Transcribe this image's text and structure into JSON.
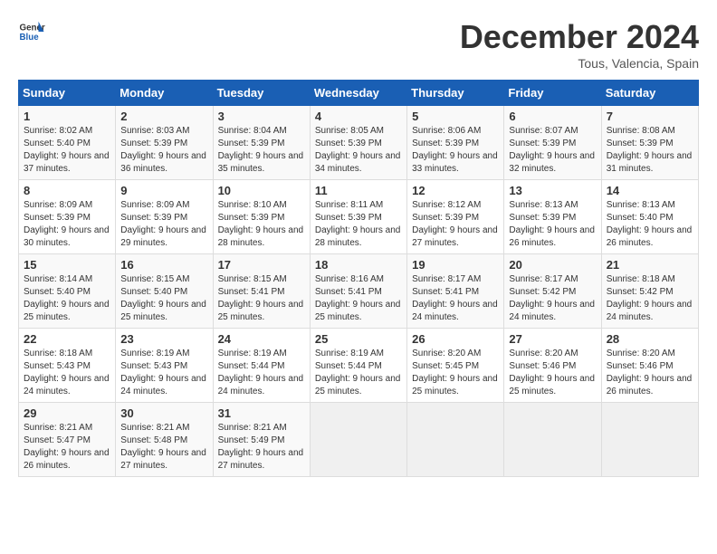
{
  "header": {
    "logo_text_general": "General",
    "logo_text_blue": "Blue",
    "month_title": "December 2024",
    "location": "Tous, Valencia, Spain"
  },
  "calendar": {
    "days_of_week": [
      "Sunday",
      "Monday",
      "Tuesday",
      "Wednesday",
      "Thursday",
      "Friday",
      "Saturday"
    ],
    "weeks": [
      [
        {
          "day": "1",
          "sunrise": "Sunrise: 8:02 AM",
          "sunset": "Sunset: 5:40 PM",
          "daylight": "Daylight: 9 hours and 37 minutes."
        },
        {
          "day": "2",
          "sunrise": "Sunrise: 8:03 AM",
          "sunset": "Sunset: 5:39 PM",
          "daylight": "Daylight: 9 hours and 36 minutes."
        },
        {
          "day": "3",
          "sunrise": "Sunrise: 8:04 AM",
          "sunset": "Sunset: 5:39 PM",
          "daylight": "Daylight: 9 hours and 35 minutes."
        },
        {
          "day": "4",
          "sunrise": "Sunrise: 8:05 AM",
          "sunset": "Sunset: 5:39 PM",
          "daylight": "Daylight: 9 hours and 34 minutes."
        },
        {
          "day": "5",
          "sunrise": "Sunrise: 8:06 AM",
          "sunset": "Sunset: 5:39 PM",
          "daylight": "Daylight: 9 hours and 33 minutes."
        },
        {
          "day": "6",
          "sunrise": "Sunrise: 8:07 AM",
          "sunset": "Sunset: 5:39 PM",
          "daylight": "Daylight: 9 hours and 32 minutes."
        },
        {
          "day": "7",
          "sunrise": "Sunrise: 8:08 AM",
          "sunset": "Sunset: 5:39 PM",
          "daylight": "Daylight: 9 hours and 31 minutes."
        }
      ],
      [
        {
          "day": "8",
          "sunrise": "Sunrise: 8:09 AM",
          "sunset": "Sunset: 5:39 PM",
          "daylight": "Daylight: 9 hours and 30 minutes."
        },
        {
          "day": "9",
          "sunrise": "Sunrise: 8:09 AM",
          "sunset": "Sunset: 5:39 PM",
          "daylight": "Daylight: 9 hours and 29 minutes."
        },
        {
          "day": "10",
          "sunrise": "Sunrise: 8:10 AM",
          "sunset": "Sunset: 5:39 PM",
          "daylight": "Daylight: 9 hours and 28 minutes."
        },
        {
          "day": "11",
          "sunrise": "Sunrise: 8:11 AM",
          "sunset": "Sunset: 5:39 PM",
          "daylight": "Daylight: 9 hours and 28 minutes."
        },
        {
          "day": "12",
          "sunrise": "Sunrise: 8:12 AM",
          "sunset": "Sunset: 5:39 PM",
          "daylight": "Daylight: 9 hours and 27 minutes."
        },
        {
          "day": "13",
          "sunrise": "Sunrise: 8:13 AM",
          "sunset": "Sunset: 5:39 PM",
          "daylight": "Daylight: 9 hours and 26 minutes."
        },
        {
          "day": "14",
          "sunrise": "Sunrise: 8:13 AM",
          "sunset": "Sunset: 5:40 PM",
          "daylight": "Daylight: 9 hours and 26 minutes."
        }
      ],
      [
        {
          "day": "15",
          "sunrise": "Sunrise: 8:14 AM",
          "sunset": "Sunset: 5:40 PM",
          "daylight": "Daylight: 9 hours and 25 minutes."
        },
        {
          "day": "16",
          "sunrise": "Sunrise: 8:15 AM",
          "sunset": "Sunset: 5:40 PM",
          "daylight": "Daylight: 9 hours and 25 minutes."
        },
        {
          "day": "17",
          "sunrise": "Sunrise: 8:15 AM",
          "sunset": "Sunset: 5:41 PM",
          "daylight": "Daylight: 9 hours and 25 minutes."
        },
        {
          "day": "18",
          "sunrise": "Sunrise: 8:16 AM",
          "sunset": "Sunset: 5:41 PM",
          "daylight": "Daylight: 9 hours and 25 minutes."
        },
        {
          "day": "19",
          "sunrise": "Sunrise: 8:17 AM",
          "sunset": "Sunset: 5:41 PM",
          "daylight": "Daylight: 9 hours and 24 minutes."
        },
        {
          "day": "20",
          "sunrise": "Sunrise: 8:17 AM",
          "sunset": "Sunset: 5:42 PM",
          "daylight": "Daylight: 9 hours and 24 minutes."
        },
        {
          "day": "21",
          "sunrise": "Sunrise: 8:18 AM",
          "sunset": "Sunset: 5:42 PM",
          "daylight": "Daylight: 9 hours and 24 minutes."
        }
      ],
      [
        {
          "day": "22",
          "sunrise": "Sunrise: 8:18 AM",
          "sunset": "Sunset: 5:43 PM",
          "daylight": "Daylight: 9 hours and 24 minutes."
        },
        {
          "day": "23",
          "sunrise": "Sunrise: 8:19 AM",
          "sunset": "Sunset: 5:43 PM",
          "daylight": "Daylight: 9 hours and 24 minutes."
        },
        {
          "day": "24",
          "sunrise": "Sunrise: 8:19 AM",
          "sunset": "Sunset: 5:44 PM",
          "daylight": "Daylight: 9 hours and 24 minutes."
        },
        {
          "day": "25",
          "sunrise": "Sunrise: 8:19 AM",
          "sunset": "Sunset: 5:44 PM",
          "daylight": "Daylight: 9 hours and 25 minutes."
        },
        {
          "day": "26",
          "sunrise": "Sunrise: 8:20 AM",
          "sunset": "Sunset: 5:45 PM",
          "daylight": "Daylight: 9 hours and 25 minutes."
        },
        {
          "day": "27",
          "sunrise": "Sunrise: 8:20 AM",
          "sunset": "Sunset: 5:46 PM",
          "daylight": "Daylight: 9 hours and 25 minutes."
        },
        {
          "day": "28",
          "sunrise": "Sunrise: 8:20 AM",
          "sunset": "Sunset: 5:46 PM",
          "daylight": "Daylight: 9 hours and 26 minutes."
        }
      ],
      [
        {
          "day": "29",
          "sunrise": "Sunrise: 8:21 AM",
          "sunset": "Sunset: 5:47 PM",
          "daylight": "Daylight: 9 hours and 26 minutes."
        },
        {
          "day": "30",
          "sunrise": "Sunrise: 8:21 AM",
          "sunset": "Sunset: 5:48 PM",
          "daylight": "Daylight: 9 hours and 27 minutes."
        },
        {
          "day": "31",
          "sunrise": "Sunrise: 8:21 AM",
          "sunset": "Sunset: 5:49 PM",
          "daylight": "Daylight: 9 hours and 27 minutes."
        },
        null,
        null,
        null,
        null
      ]
    ]
  }
}
